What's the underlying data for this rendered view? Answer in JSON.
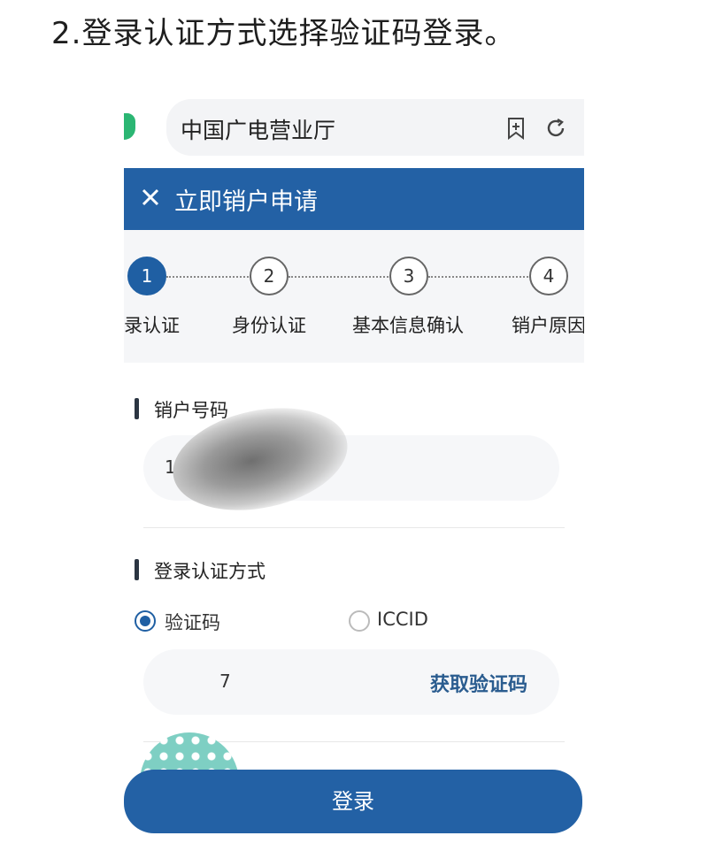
{
  "caption": "2.登录认证方式选择验证码登录。",
  "browser": {
    "url_title": "中国广电营业厅",
    "icons": [
      "shield-icon",
      "bookmark-add-icon",
      "reload-icon"
    ]
  },
  "header": {
    "title": "立即销户申请",
    "close_icon": "close-icon"
  },
  "steps": [
    {
      "number": "1",
      "label": "录认证",
      "active": true
    },
    {
      "number": "2",
      "label": "身份认证",
      "active": false
    },
    {
      "number": "3",
      "label": "基本信息确认",
      "active": false
    },
    {
      "number": "4",
      "label": "销户原因",
      "active": false
    }
  ],
  "form": {
    "account_section_title": "销户号码",
    "account_value": "19",
    "auth_section_title": "登录认证方式",
    "auth_options": [
      {
        "label": "验证码",
        "selected": true
      },
      {
        "label": "ICCID",
        "selected": false
      }
    ],
    "code_input_value": "7",
    "get_code_label": "获取验证码",
    "submit_label": "登录"
  },
  "colors": {
    "primary_blue": "#2361a5",
    "brand_green": "#2bb673",
    "step_bg": "#f5f6f8"
  }
}
